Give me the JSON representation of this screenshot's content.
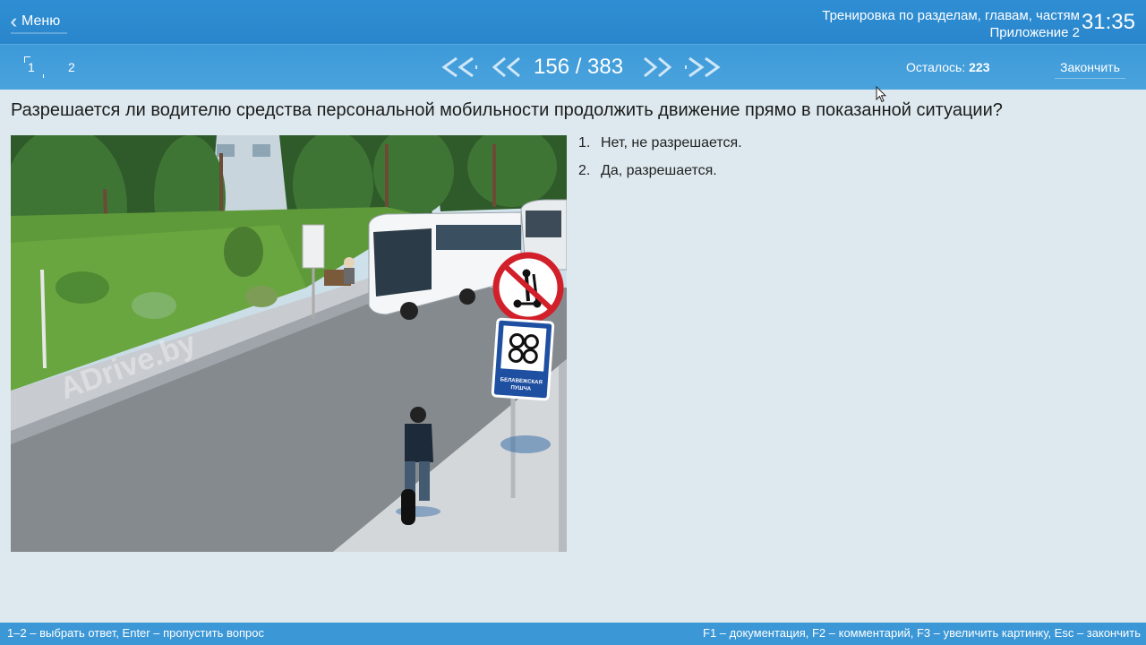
{
  "header": {
    "menu_label": "Меню",
    "title_line1": "Тренировка по разделам, главам, частям",
    "title_line2": "Приложение 2",
    "timer": "31:35"
  },
  "nav": {
    "pages": [
      "1",
      "2"
    ],
    "counter": "156 / 383",
    "remaining_label": "Осталось:",
    "remaining_value": "223",
    "finish_label": "Закончить"
  },
  "question": {
    "text": "Разрешается ли водителю средства персональной мобильности продолжить движение прямо в показанной ситуации?",
    "answers": [
      {
        "num": "1.",
        "text": "Нет, не разрешается."
      },
      {
        "num": "2.",
        "text": "Да, разрешается."
      }
    ],
    "image": {
      "watermark": "ADrive.by",
      "sign_caption_line1": "БЕЛАВЕЖСКАЯ",
      "sign_caption_line2": "ПУШЧА"
    }
  },
  "footer": {
    "hint_left": "1–2 – выбрать ответ, Enter – пропустить вопрос",
    "hint_right": "F1 – документация, F2 – комментарий, F3 – увеличить картинку, Esc – закончить"
  },
  "colors": {
    "topbar": "#2f8ed3",
    "navbar": "#4aa3dd",
    "background": "#dde9ee",
    "footer": "#3b97d6"
  }
}
